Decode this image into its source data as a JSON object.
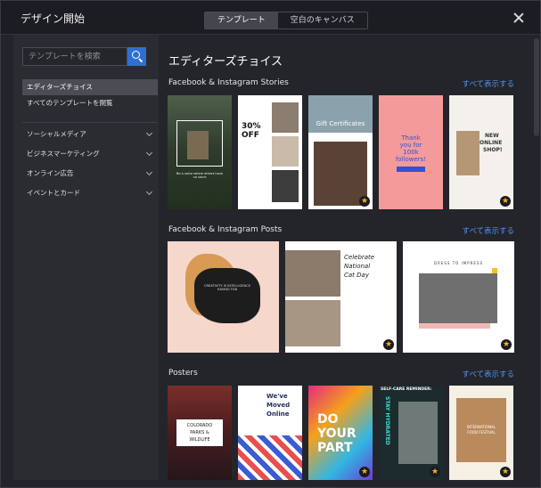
{
  "header": {
    "title": "デザイン開始",
    "tabs": [
      {
        "label": "テンプレート",
        "active": true
      },
      {
        "label": "空白のキャンバス",
        "active": false
      }
    ]
  },
  "sidebar": {
    "search_placeholder": "テンプレートを検索",
    "items": [
      {
        "label": "エディターズチョイス",
        "selected": true
      },
      {
        "label": "すべてのテンプレートを閲覧",
        "selected": false
      }
    ],
    "categories": [
      {
        "label": "ソーシャルメディア"
      },
      {
        "label": "ビジネスマーケティング"
      },
      {
        "label": "オンライン広告"
      },
      {
        "label": "イベントとカード"
      }
    ]
  },
  "main": {
    "title": "エディターズチョイス",
    "sections": [
      {
        "title": "Facebook & Instagram Stories",
        "show_all": "すべて表示する",
        "thumbs": [
          {
            "name": "story-forest",
            "text": "Be a voice where others have no voice",
            "premium": false
          },
          {
            "name": "story-fashion-sale",
            "text1": "30%",
            "text2": "OFF",
            "premium": false
          },
          {
            "name": "story-gift-certificates",
            "text": "Gift Certificates",
            "premium": true
          },
          {
            "name": "story-followers",
            "text1": "Thank",
            "text2": "you for",
            "text3": "100k",
            "text4": "followers!",
            "premium": false
          },
          {
            "name": "story-online-shop",
            "text1": "NEW",
            "text2": "ONLINE",
            "text3": "SHOP!",
            "premium": true
          }
        ]
      },
      {
        "title": "Facebook & Instagram Posts",
        "show_all": "すべて表示する",
        "thumbs": [
          {
            "name": "post-creativity",
            "text": "CREATIVITY IS INTELLIGENCE HAVING FUN",
            "premium": false
          },
          {
            "name": "post-cat-day",
            "text1": "Celebrate",
            "text2": "National",
            "text3": "Cat Day",
            "premium": true
          },
          {
            "name": "post-dress-to-impress",
            "text": "DRESS TO IMPRESS",
            "premium": true
          }
        ]
      },
      {
        "title": "Posters",
        "show_all": "すべて表示する",
        "thumbs": [
          {
            "name": "poster-colorado",
            "text1": "COLORADO",
            "text2": "PARKS &",
            "text3": "WILDLIFE",
            "premium": false
          },
          {
            "name": "poster-moved-online",
            "text1": "We've",
            "text2": "Moved",
            "text3": "Online",
            "premium": false
          },
          {
            "name": "poster-do-your-part",
            "text1": "DO",
            "text2": "YOUR",
            "text3": "PART",
            "premium": true
          },
          {
            "name": "poster-self-care",
            "text1": "SELF-CARE REMINDER:",
            "text2": "STAY HYDRATED",
            "premium": true
          },
          {
            "name": "poster-food-festival",
            "text1": "INTERNATIONAL",
            "text2": "FOOD FESTIVAL",
            "premium": true
          }
        ]
      }
    ]
  },
  "icons": {
    "premium": "star-badge-icon",
    "search": "search-icon",
    "close": "close-icon"
  },
  "colors": {
    "accent": "#2f6fd1",
    "link": "#4f93ef",
    "premium": "#f3b51c"
  }
}
